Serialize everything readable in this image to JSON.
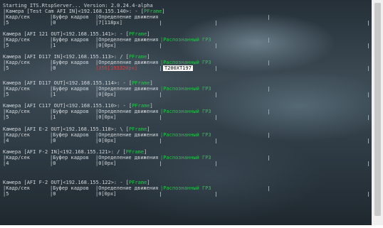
{
  "header": "Starting ITS.RtspServer... Version: 2.0.24.4-alpha",
  "columns": {
    "fps": "|Кадр/сек",
    "buffer": "|Буфер кадров",
    "motion": "|Определение движения",
    "recognized": "|Распознанный ГРЗ"
  },
  "cameras": [
    {
      "title": "|Камера [Test Cam AFI IN]<192.168.155.140>: - [",
      "tag": "PFrame",
      "tail": "]",
      "fps": "|5",
      "buffer": "|0",
      "motion": "|7[118px]",
      "recognized": "",
      "plate": ""
    },
    {
      "title": "Камера [AFI 121 OUT]<192.168.155.141>: - [",
      "tag": "PFrame",
      "tail": "]",
      "fps": "|5",
      "buffer": "|1",
      "motion": "|0[0px]",
      "recognized": "|Распознанный ГРЗ",
      "plate": ""
    },
    {
      "title": "Камера [AFI D117 IN]<192.168.155.113>: / [",
      "tag": "PFrame",
      "tail": "]",
      "fps": "|5",
      "buffer": "|0",
      "motion": "|356[193320px]",
      "recognized": "|Распознанный ГРЗ",
      "plate": "T200XT197"
    },
    {
      "title": "Камера [AFI D117 OUT]<192.168.155.114>: - [",
      "tag": "PFrame",
      "tail": "]",
      "fps": "|5",
      "buffer": "|1",
      "motion": "|0[0px]",
      "recognized": "|Распознанный ГРЗ",
      "plate": ""
    },
    {
      "title": "Камера [AFI C117 OUT]<192.168.155.110>: - [",
      "tag": "PFrame",
      "tail": "]",
      "fps": "|5",
      "buffer": "|1",
      "motion": "|0[0px]",
      "recognized": "|Распознанный ГРЗ",
      "plate": ""
    },
    {
      "title": "Камера [AFI E-2 OUT]<192.168.155.118>: \\ [",
      "tag": "PFrame",
      "tail": "]",
      "fps": "|4",
      "buffer": "|0",
      "motion": "|0[0px]",
      "recognized": "|Распознанный ГРЗ",
      "plate": ""
    },
    {
      "title": "Камера [AFI F-2 IN]<192.168.155.121>: / [",
      "tag": "PFrame",
      "tail": "]",
      "fps": "|4",
      "buffer": "|0",
      "motion": "|0[0px]",
      "recognized": "|Распознанный ГРЗ",
      "plate": ""
    },
    {
      "title": "Камера [AFI F-2 OUT]<192.168.155.122>: - [",
      "tag": "PFrame",
      "tail": "]",
      "fps": "|5",
      "buffer": "|0",
      "motion": "|0[0px]",
      "recognized": "|Распознанный ГРЗ",
      "plate": ""
    }
  ],
  "colors": {
    "active_tag": "#24c64a",
    "motion_alert": "#e23b3b",
    "recognized": "#24c64a"
  }
}
